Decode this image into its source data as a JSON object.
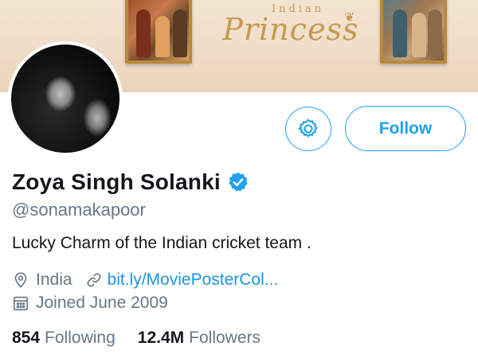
{
  "banner": {
    "title_small": "Indian",
    "title_big": "Princess"
  },
  "actions": {
    "follow_label": "Follow"
  },
  "profile": {
    "name": "Zoya Singh Solanki",
    "handle": "@sonamakapoor",
    "bio": "Lucky Charm of the Indian cricket team .",
    "location": "India",
    "website": "bit.ly/MoviePosterCol...",
    "joined": "Joined June 2009"
  },
  "stats": {
    "following_count": "854",
    "following_label": "Following",
    "followers_count": "12.4M",
    "followers_label": "Followers"
  },
  "icons": {
    "settings": "gear-icon",
    "verified": "verified-badge-icon",
    "location": "location-pin-icon",
    "link": "link-icon",
    "calendar": "calendar-icon"
  },
  "colors": {
    "accent": "#1da1f2",
    "link": "#1b95e0",
    "muted": "#657786",
    "text": "#14171a"
  }
}
